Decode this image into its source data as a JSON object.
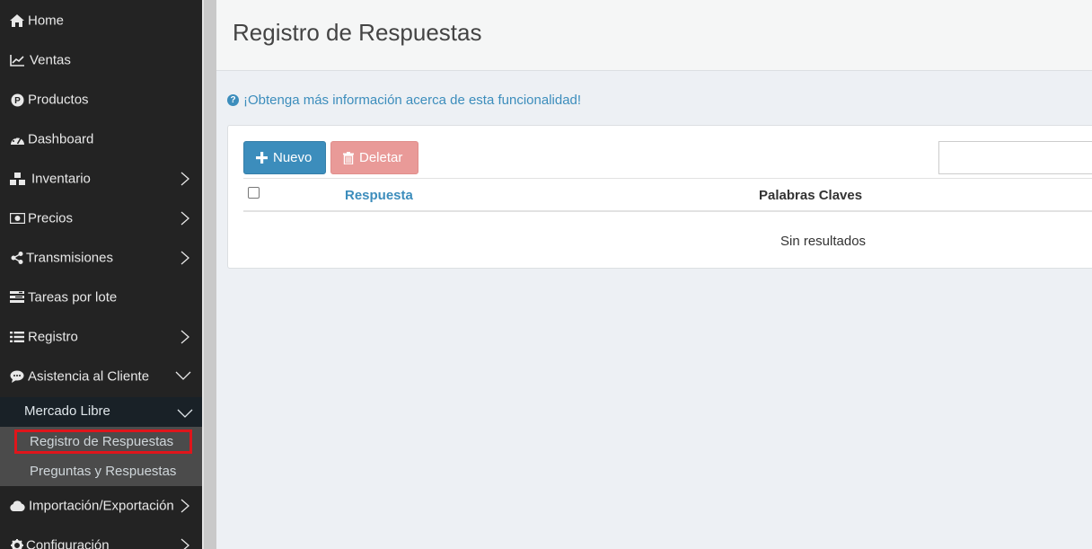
{
  "sidebar": {
    "items": [
      {
        "label": "Home",
        "icon": "home-icon",
        "has_children": false
      },
      {
        "label": "Ventas",
        "icon": "line-chart-icon",
        "has_children": false
      },
      {
        "label": "Productos",
        "icon": "product-p-icon",
        "has_children": false
      },
      {
        "label": "Dashboard",
        "icon": "dashboard-icon",
        "has_children": false
      },
      {
        "label": "Inventario",
        "icon": "cubes-icon",
        "has_children": true
      },
      {
        "label": "Precios",
        "icon": "money-icon",
        "has_children": true
      },
      {
        "label": "Transmisiones",
        "icon": "share-icon",
        "has_children": true
      },
      {
        "label": "Tareas por lote",
        "icon": "tasks-icon",
        "has_children": false
      },
      {
        "label": "Registro",
        "icon": "list-icon",
        "has_children": true
      },
      {
        "label": "Asistencia al Cliente",
        "icon": "comment-icon",
        "has_children": true,
        "expanded": true
      },
      {
        "label": "Importación/Exportación",
        "icon": "cloud-icon",
        "has_children": true
      },
      {
        "label": "Configuración",
        "icon": "gear-icon",
        "has_children": true
      }
    ],
    "submenu": {
      "label": "Mercado Libre",
      "items": [
        {
          "label": "Registro de Respuestas",
          "active": true
        },
        {
          "label": "Preguntas y Respuestas",
          "active": false
        }
      ]
    }
  },
  "header": {
    "title": "Registro de Respuestas"
  },
  "info_link": "¡Obtenga más información acerca de esta funcionalidad!",
  "toolbar": {
    "new_label": "Nuevo",
    "delete_label": "Deletar",
    "search_value": ""
  },
  "table": {
    "columns": [
      "Respuesta",
      "Palabras Claves"
    ],
    "empty_text": "Sin resultados"
  },
  "colors": {
    "sidebar_bg": "#232323",
    "primary": "#3c8dbc",
    "danger_disabled": "#e99a98",
    "highlight": "#e0151b"
  }
}
